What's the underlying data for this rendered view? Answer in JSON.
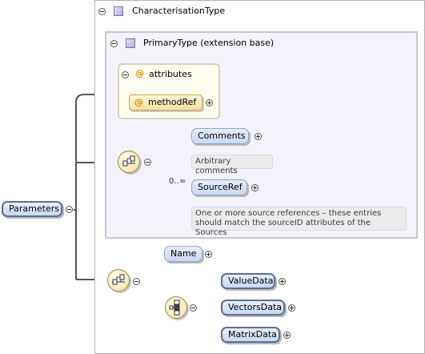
{
  "root": {
    "label": "Parameters"
  },
  "characterisation": {
    "title": "CharacterisationType"
  },
  "primary": {
    "title": "PrimaryType (extension base)"
  },
  "attributes": {
    "title": "attributes",
    "method_ref": "methodRef"
  },
  "sequence_one": {
    "comments": {
      "label": "Comments",
      "annotation": "Arbitrary comments"
    },
    "source_ref": {
      "label": "SourceRef",
      "cardinality": "0..∞",
      "annotation_line1": "One or more source references – these entries",
      "annotation_line2": "should match the sourceID attributes of the Sources"
    }
  },
  "sequence_two": {
    "name": {
      "label": "Name"
    }
  },
  "choice": {
    "value_data": {
      "label": "ValueData"
    },
    "vectors_data": {
      "label": "VectorsData"
    },
    "matrix_data": {
      "label": "MatrixData"
    }
  },
  "icons": {
    "collapse": "minus-circle-icon",
    "expand": "plus-circle-icon",
    "type": "complex-type-icon",
    "attribute": "at-sign-icon",
    "sequence": "sequence-compositor-icon",
    "choice": "choice-compositor-icon"
  },
  "colors": {
    "element_fill": "#c9d8f2",
    "element_border": "#5b6e96",
    "compositor_fill": "#f1e2a0",
    "attribute_fill": "#f7dfa0",
    "extension_bg": "#f4f2fa",
    "annotation_bg": "#ececec"
  }
}
